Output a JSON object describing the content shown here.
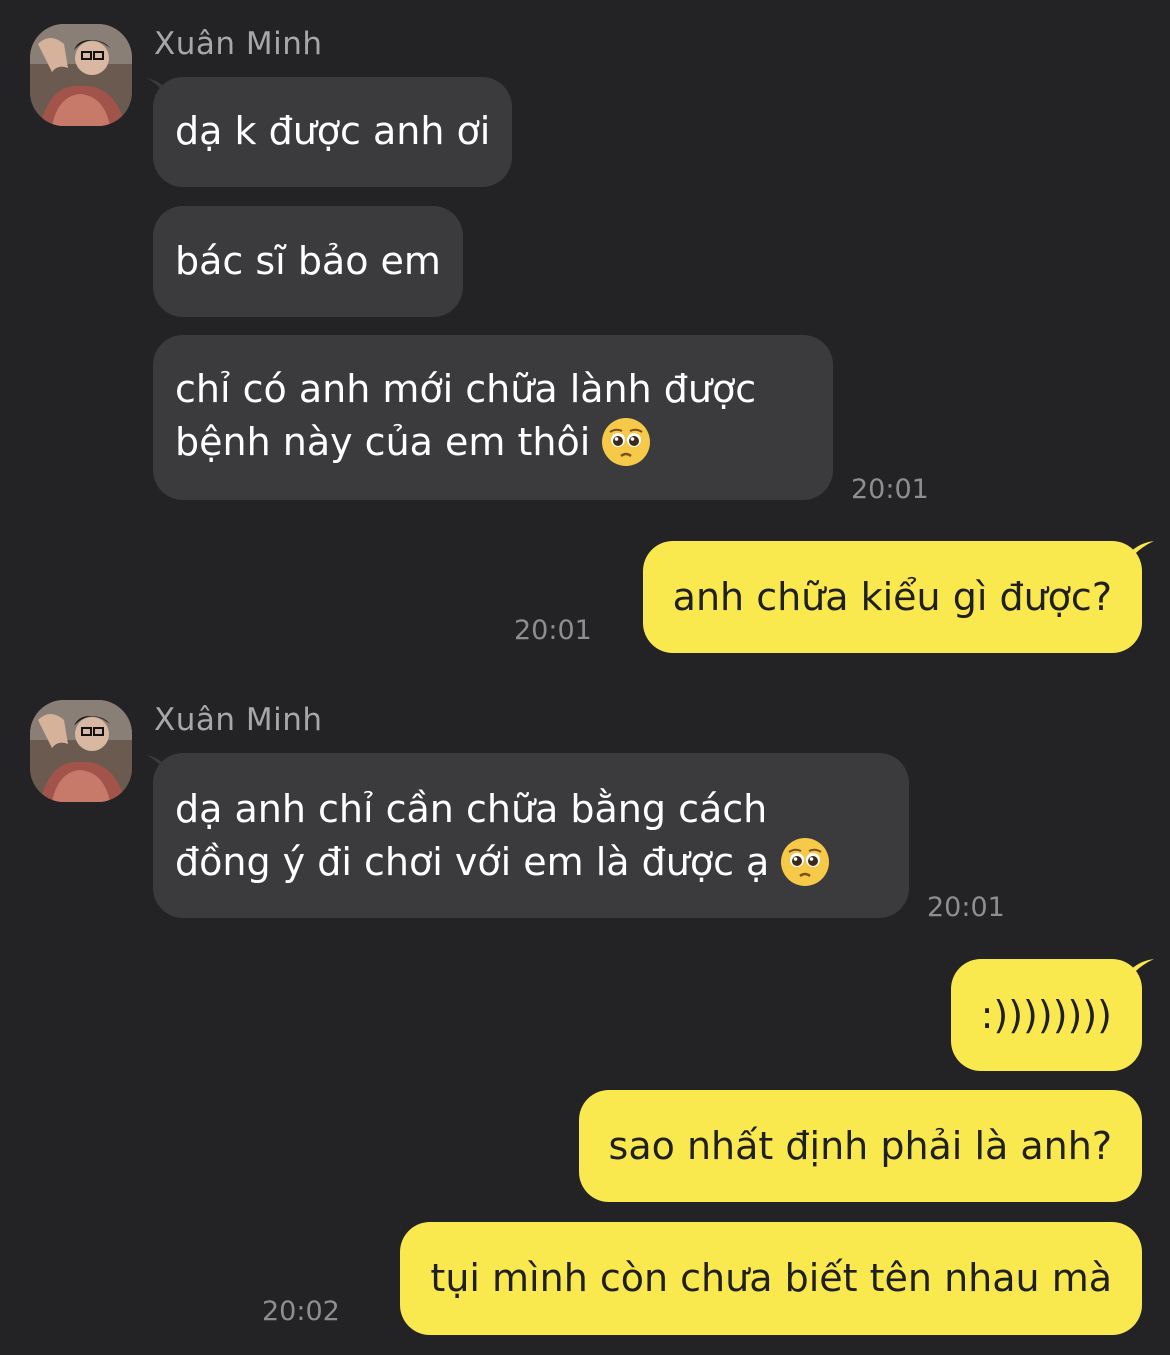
{
  "conversation": {
    "sender_name": "Xuân Minh",
    "group1": {
      "msg1": "dạ k được anh ơi",
      "msg2": "bác sĩ bảo em",
      "msg3_line1": "chỉ có anh mới chữa lành được",
      "msg3_line2": "bệnh này của em thôi",
      "msg3_emoji": "pleading-face-emoji",
      "time": "20:01"
    },
    "out1": {
      "msg": "anh chữa kiểu gì được?",
      "time": "20:01"
    },
    "group2": {
      "msg_line1": "dạ anh chỉ cần chữa bằng cách",
      "msg_line2": "đồng ý đi chơi với em là được ạ",
      "msg_emoji": "pleading-face-emoji",
      "time": "20:01"
    },
    "out2": {
      "msg1": ":))))))))",
      "msg2": "sao nhất định phải là anh?",
      "msg3": "tụi mình còn chưa biết tên nhau mà",
      "time": "20:02"
    }
  },
  "colors": {
    "background": "#232325",
    "incoming_bubble": "#3b3b3e",
    "outgoing_bubble": "#fae84f",
    "sender_name": "#a7a7a9",
    "timestamp": "#8e8e92"
  }
}
